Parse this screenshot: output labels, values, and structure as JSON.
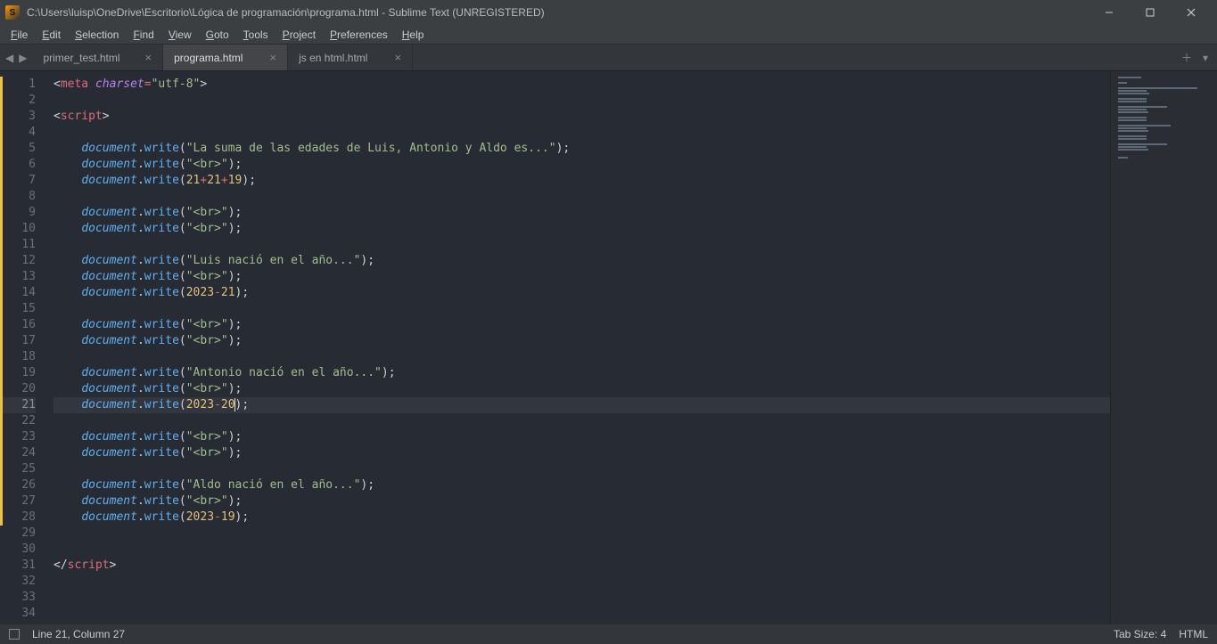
{
  "window": {
    "title": "C:\\Users\\luisp\\OneDrive\\Escritorio\\Lógica de programación\\programa.html - Sublime Text (UNREGISTERED)",
    "app_icon_letter": "S"
  },
  "menu": {
    "items": [
      "File",
      "Edit",
      "Selection",
      "Find",
      "View",
      "Goto",
      "Tools",
      "Project",
      "Preferences",
      "Help"
    ]
  },
  "tabs": {
    "items": [
      {
        "label": "primer_test.html",
        "active": false
      },
      {
        "label": "programa.html",
        "active": true
      },
      {
        "label": "js en html.html",
        "active": false
      }
    ]
  },
  "editor": {
    "line_count": 34,
    "current_line": 21,
    "lines": [
      {
        "n": 1,
        "ind": 0,
        "tokens": [
          [
            "<",
            "p-punc"
          ],
          [
            "meta",
            "p-tag"
          ],
          [
            " ",
            "p-punc"
          ],
          [
            "charset",
            "p-attr"
          ],
          [
            "=",
            "p-op"
          ],
          [
            "\"utf-8\"",
            "p-str"
          ],
          [
            ">",
            "p-punc"
          ]
        ]
      },
      {
        "n": 2,
        "ind": 0,
        "tokens": []
      },
      {
        "n": 3,
        "ind": 0,
        "tokens": [
          [
            "<",
            "p-punc"
          ],
          [
            "script",
            "p-tag"
          ],
          [
            ">",
            "p-punc"
          ]
        ]
      },
      {
        "n": 4,
        "ind": 0,
        "tokens": []
      },
      {
        "n": 5,
        "ind": 1,
        "tokens": [
          [
            "document",
            "p-obj"
          ],
          [
            ".",
            "p-punc"
          ],
          [
            "write",
            "p-fn"
          ],
          [
            "(",
            "p-punc"
          ],
          [
            "\"La suma de las edades de Luis, Antonio y Aldo es...\"",
            "p-str"
          ],
          [
            ")",
            "p-punc"
          ],
          [
            ";",
            "p-punc"
          ]
        ]
      },
      {
        "n": 6,
        "ind": 1,
        "tokens": [
          [
            "document",
            "p-obj"
          ],
          [
            ".",
            "p-punc"
          ],
          [
            "write",
            "p-fn"
          ],
          [
            "(",
            "p-punc"
          ],
          [
            "\"<br>\"",
            "p-str"
          ],
          [
            ")",
            "p-punc"
          ],
          [
            ";",
            "p-punc"
          ]
        ]
      },
      {
        "n": 7,
        "ind": 1,
        "tokens": [
          [
            "document",
            "p-obj"
          ],
          [
            ".",
            "p-punc"
          ],
          [
            "write",
            "p-fn"
          ],
          [
            "(",
            "p-punc"
          ],
          [
            "21",
            "p-num"
          ],
          [
            "+",
            "p-op"
          ],
          [
            "21",
            "p-num"
          ],
          [
            "+",
            "p-op"
          ],
          [
            "19",
            "p-num"
          ],
          [
            ")",
            "p-punc"
          ],
          [
            ";",
            "p-punc"
          ]
        ]
      },
      {
        "n": 8,
        "ind": 0,
        "tokens": []
      },
      {
        "n": 9,
        "ind": 1,
        "tokens": [
          [
            "document",
            "p-obj"
          ],
          [
            ".",
            "p-punc"
          ],
          [
            "write",
            "p-fn"
          ],
          [
            "(",
            "p-punc"
          ],
          [
            "\"<br>\"",
            "p-str"
          ],
          [
            ")",
            "p-punc"
          ],
          [
            ";",
            "p-punc"
          ]
        ]
      },
      {
        "n": 10,
        "ind": 1,
        "tokens": [
          [
            "document",
            "p-obj"
          ],
          [
            ".",
            "p-punc"
          ],
          [
            "write",
            "p-fn"
          ],
          [
            "(",
            "p-punc"
          ],
          [
            "\"<br>\"",
            "p-str"
          ],
          [
            ")",
            "p-punc"
          ],
          [
            ";",
            "p-punc"
          ]
        ]
      },
      {
        "n": 11,
        "ind": 0,
        "tokens": []
      },
      {
        "n": 12,
        "ind": 1,
        "tokens": [
          [
            "document",
            "p-obj"
          ],
          [
            ".",
            "p-punc"
          ],
          [
            "write",
            "p-fn"
          ],
          [
            "(",
            "p-punc"
          ],
          [
            "\"Luis nació en el año...\"",
            "p-str"
          ],
          [
            ")",
            "p-punc"
          ],
          [
            ";",
            "p-punc"
          ]
        ]
      },
      {
        "n": 13,
        "ind": 1,
        "tokens": [
          [
            "document",
            "p-obj"
          ],
          [
            ".",
            "p-punc"
          ],
          [
            "write",
            "p-fn"
          ],
          [
            "(",
            "p-punc"
          ],
          [
            "\"<br>\"",
            "p-str"
          ],
          [
            ")",
            "p-punc"
          ],
          [
            ";",
            "p-punc"
          ]
        ]
      },
      {
        "n": 14,
        "ind": 1,
        "tokens": [
          [
            "document",
            "p-obj"
          ],
          [
            ".",
            "p-punc"
          ],
          [
            "write",
            "p-fn"
          ],
          [
            "(",
            "p-punc"
          ],
          [
            "2023",
            "p-num"
          ],
          [
            "-",
            "p-op"
          ],
          [
            "21",
            "p-num"
          ],
          [
            ")",
            "p-punc"
          ],
          [
            ";",
            "p-punc"
          ]
        ]
      },
      {
        "n": 15,
        "ind": 0,
        "tokens": []
      },
      {
        "n": 16,
        "ind": 1,
        "tokens": [
          [
            "document",
            "p-obj"
          ],
          [
            ".",
            "p-punc"
          ],
          [
            "write",
            "p-fn"
          ],
          [
            "(",
            "p-punc"
          ],
          [
            "\"<br>\"",
            "p-str"
          ],
          [
            ")",
            "p-punc"
          ],
          [
            ";",
            "p-punc"
          ]
        ]
      },
      {
        "n": 17,
        "ind": 1,
        "tokens": [
          [
            "document",
            "p-obj"
          ],
          [
            ".",
            "p-punc"
          ],
          [
            "write",
            "p-fn"
          ],
          [
            "(",
            "p-punc"
          ],
          [
            "\"<br>\"",
            "p-str"
          ],
          [
            ")",
            "p-punc"
          ],
          [
            ";",
            "p-punc"
          ]
        ]
      },
      {
        "n": 18,
        "ind": 0,
        "tokens": []
      },
      {
        "n": 19,
        "ind": 1,
        "tokens": [
          [
            "document",
            "p-obj"
          ],
          [
            ".",
            "p-punc"
          ],
          [
            "write",
            "p-fn"
          ],
          [
            "(",
            "p-punc"
          ],
          [
            "\"Antonio nació en el año...\"",
            "p-str"
          ],
          [
            ")",
            "p-punc"
          ],
          [
            ";",
            "p-punc"
          ]
        ]
      },
      {
        "n": 20,
        "ind": 1,
        "tokens": [
          [
            "document",
            "p-obj"
          ],
          [
            ".",
            "p-punc"
          ],
          [
            "write",
            "p-fn"
          ],
          [
            "(",
            "p-punc"
          ],
          [
            "\"<br>\"",
            "p-str"
          ],
          [
            ")",
            "p-punc"
          ],
          [
            ";",
            "p-punc"
          ]
        ]
      },
      {
        "n": 21,
        "ind": 1,
        "tokens": [
          [
            "document",
            "p-obj"
          ],
          [
            ".",
            "p-punc"
          ],
          [
            "write",
            "p-fn"
          ],
          [
            "(",
            "p-punc"
          ],
          [
            "2023",
            "p-num"
          ],
          [
            "-",
            "p-op"
          ],
          [
            "20",
            "p-num"
          ],
          [
            ")",
            "p-punc"
          ],
          [
            ";",
            "p-punc"
          ]
        ],
        "cursor_after_token": 6
      },
      {
        "n": 22,
        "ind": 0,
        "tokens": []
      },
      {
        "n": 23,
        "ind": 1,
        "tokens": [
          [
            "document",
            "p-obj"
          ],
          [
            ".",
            "p-punc"
          ],
          [
            "write",
            "p-fn"
          ],
          [
            "(",
            "p-punc"
          ],
          [
            "\"<br>\"",
            "p-str"
          ],
          [
            ")",
            "p-punc"
          ],
          [
            ";",
            "p-punc"
          ]
        ]
      },
      {
        "n": 24,
        "ind": 1,
        "tokens": [
          [
            "document",
            "p-obj"
          ],
          [
            ".",
            "p-punc"
          ],
          [
            "write",
            "p-fn"
          ],
          [
            "(",
            "p-punc"
          ],
          [
            "\"<br>\"",
            "p-str"
          ],
          [
            ")",
            "p-punc"
          ],
          [
            ";",
            "p-punc"
          ]
        ]
      },
      {
        "n": 25,
        "ind": 0,
        "tokens": []
      },
      {
        "n": 26,
        "ind": 1,
        "tokens": [
          [
            "document",
            "p-obj"
          ],
          [
            ".",
            "p-punc"
          ],
          [
            "write",
            "p-fn"
          ],
          [
            "(",
            "p-punc"
          ],
          [
            "\"Aldo nació en el año...\"",
            "p-str"
          ],
          [
            ")",
            "p-punc"
          ],
          [
            ";",
            "p-punc"
          ]
        ]
      },
      {
        "n": 27,
        "ind": 1,
        "tokens": [
          [
            "document",
            "p-obj"
          ],
          [
            ".",
            "p-punc"
          ],
          [
            "write",
            "p-fn"
          ],
          [
            "(",
            "p-punc"
          ],
          [
            "\"<br>\"",
            "p-str"
          ],
          [
            ")",
            "p-punc"
          ],
          [
            ";",
            "p-punc"
          ]
        ]
      },
      {
        "n": 28,
        "ind": 1,
        "tokens": [
          [
            "document",
            "p-obj"
          ],
          [
            ".",
            "p-punc"
          ],
          [
            "write",
            "p-fn"
          ],
          [
            "(",
            "p-punc"
          ],
          [
            "2023",
            "p-num"
          ],
          [
            "-",
            "p-op"
          ],
          [
            "19",
            "p-num"
          ],
          [
            ")",
            "p-punc"
          ],
          [
            ";",
            "p-punc"
          ]
        ]
      },
      {
        "n": 29,
        "ind": 0,
        "tokens": []
      },
      {
        "n": 30,
        "ind": 0,
        "tokens": []
      },
      {
        "n": 31,
        "ind": 0,
        "tokens": [
          [
            "</",
            "p-punc"
          ],
          [
            "script",
            "p-tag"
          ],
          [
            ">",
            "p-punc"
          ]
        ]
      },
      {
        "n": 32,
        "ind": 0,
        "tokens": []
      },
      {
        "n": 33,
        "ind": 0,
        "tokens": []
      },
      {
        "n": 34,
        "ind": 0,
        "tokens": []
      }
    ],
    "modified_lines_start": 1,
    "modified_lines_end": 28
  },
  "status": {
    "position": "Line 21, Column 27",
    "tab_size": "Tab Size: 4",
    "syntax": "HTML"
  }
}
